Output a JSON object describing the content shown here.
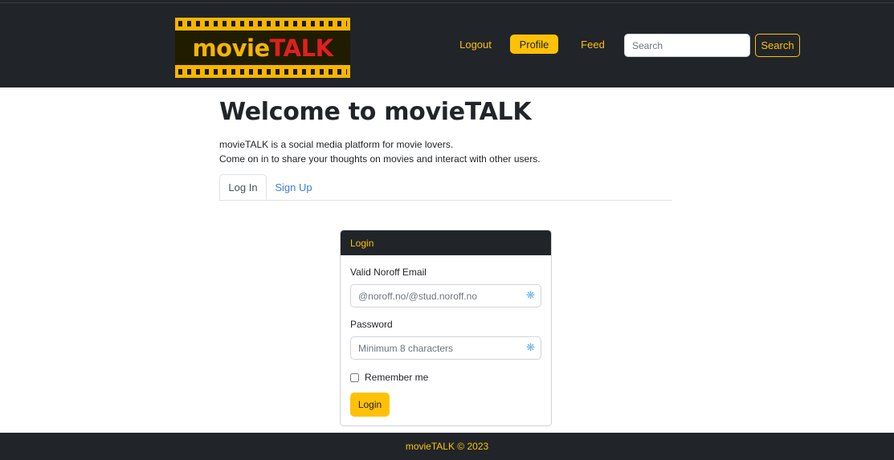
{
  "header": {
    "logo": {
      "part1": "movie",
      "part2": "TALK"
    },
    "nav": {
      "logout": "Logout",
      "profile": "Profile",
      "feed": "Feed"
    },
    "search": {
      "placeholder": "Search",
      "button": "Search"
    }
  },
  "main": {
    "title": "Welcome to movieTALK",
    "intro_line1": "movieTALK is a social media platform for movie lovers.",
    "intro_line2": "Come on in to share your thoughts on movies and interact with other users.",
    "tabs": [
      {
        "label": "Log In",
        "active": true
      },
      {
        "label": "Sign Up",
        "active": false
      }
    ]
  },
  "login_card": {
    "header": "Login",
    "email_label": "Valid Noroff Email",
    "email_placeholder": "@noroff.no/@stud.noroff.no",
    "password_label": "Password",
    "password_placeholder": "Minimum 8 characters",
    "remember_label": "Remember me",
    "submit_label": "Login",
    "field_icon": "password-manager-icon"
  },
  "footer": {
    "text": "movieTALK © 2023"
  },
  "colors": {
    "accent": "#ffc107",
    "dark": "#212529",
    "link": "#3d7dd8",
    "logo_red": "#e0201b"
  }
}
